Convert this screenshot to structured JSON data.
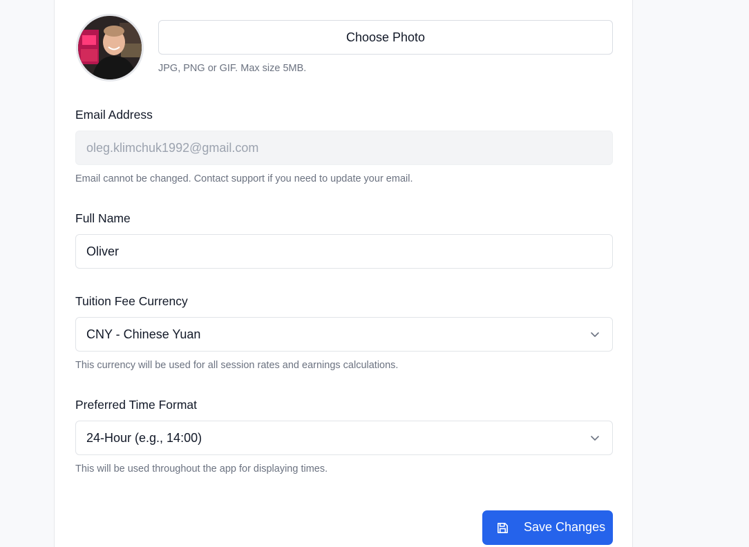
{
  "profile": {
    "photo_button_label": "Choose Photo",
    "photo_hint": "JPG, PNG or GIF. Max size 5MB."
  },
  "email": {
    "label": "Email Address",
    "value": "oleg.klimchuk1992@gmail.com",
    "hint": "Email cannot be changed. Contact support if you need to update your email."
  },
  "full_name": {
    "label": "Full Name",
    "value": "Oliver"
  },
  "currency": {
    "label": "Tuition Fee Currency",
    "selected": "CNY - Chinese Yuan",
    "hint": "This currency will be used for all session rates and earnings calculations."
  },
  "time_format": {
    "label": "Preferred Time Format",
    "selected": "24-Hour (e.g., 14:00)",
    "hint": "This will be used throughout the app for displaying times."
  },
  "actions": {
    "save_label": "Save Changes"
  },
  "colors": {
    "primary": "#2563eb",
    "page_bg": "#f8f9fb",
    "muted_text": "#6b7280"
  },
  "icons": {
    "select_chevron": "chevron-down-icon",
    "save": "floppy-disk-icon"
  }
}
